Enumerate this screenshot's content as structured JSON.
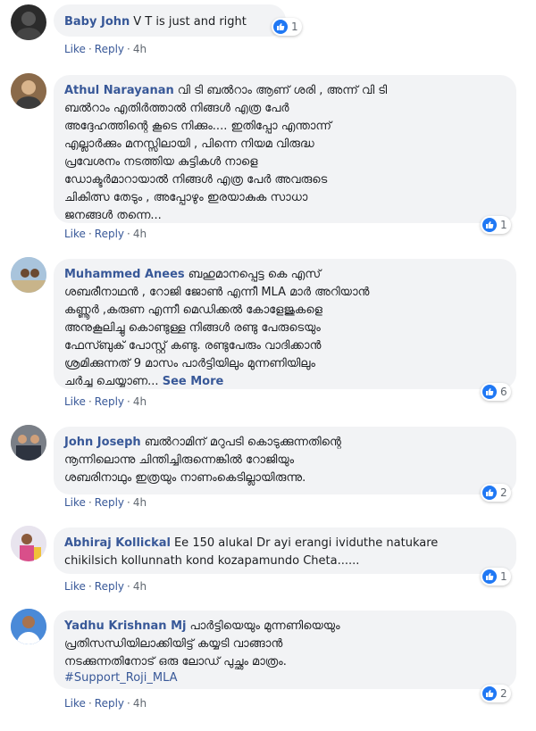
{
  "comments": [
    {
      "author": "Baby John",
      "text": "V T is just and right",
      "reactions": "1",
      "like_label": "Like",
      "reply_label": "Reply",
      "time": "4h"
    },
    {
      "author": "Athul Narayanan",
      "text": "വി ടി ബൽറാം ആണ് ശരി , അന്ന് വി ടി\nബൽറാം എതിർത്താൽ നിങ്ങൾ എത്ര പേർ\nഅദ്ദേഹത്തിന്റെ കൂടെ നിക്കും.... ഇതിപ്പോ എന്താന്ന്\nഎല്ലാർക്കും മനസ്സിലായി , പിന്നെ നിയമ വിരുദ്ധ\nപ്രവേശനം നടത്തിയ കുട്ടികൾ നാളെ\nഡോക്ടർമാറായാൽ നിങ്ങൾ എത്ര പേർ അവരുടെ\nചികിത്സ തേടും , അപ്പോഴും ഇരയാകുക സാധാ\nജനങ്ങൾ തന്നെ...",
      "reactions": "1",
      "like_label": "Like",
      "reply_label": "Reply",
      "time": "4h"
    },
    {
      "author": "Muhammed Anees",
      "text": "ബഹുമാനപ്പെട്ട കെ എസ്\nശബരീനാഥൻ , റോജി ജോൺ എന്നീ MLA മാർ അറിയാൻ\nകണ്ണൂർ ,കരുണ എന്നീ മെഡിക്കൽ കോളേജുകളെ\nഅനുകൂലിച്ചു കൊണ്ടുള്ള നിങ്ങൾ രണ്ടു പേരുടെയും\nഫേസ്ബുക് പോസ്റ്റ്‌ കണ്ടു. രണ്ടുപേരും വാദിക്കാൻ\nശ്രമിക്കുന്നത് 9 മാസം പാർട്ടിയിലും മുന്നണിയിലും\nചർച്ച ചെയ്യാണ...",
      "see_more": "See More",
      "reactions": "6",
      "like_label": "Like",
      "reply_label": "Reply",
      "time": "4h"
    },
    {
      "author": "John Joseph",
      "text": "ബൽറാമിന് മറുപടി കൊടുക്കുന്നതിന്റെ\nനൂന്നിലൊന്നു ചിന്തിച്ചിരുന്നെങ്കിൽ റോജിയും\nശബരിനാഥും ഇത്രയും നാണംകെടില്ലായിരുന്നു.",
      "reactions": "2",
      "like_label": "Like",
      "reply_label": "Reply",
      "time": "4h"
    },
    {
      "author": "Abhiraj Kollickal",
      "text": "Ee 150 alukal Dr ayi erangi ividuthe natukare\nchikilsich kollunnath kond kozapamundo Cheta......",
      "reactions": "1",
      "like_label": "Like",
      "reply_label": "Reply",
      "time": "4h"
    },
    {
      "author": "Yadhu Krishnan Mj",
      "text": "പാർട്ടിയെയും മുന്നണിയെയും\nപ്രതിസന്ധിയിലാക്കിയിട്ട് കയ്യടി വാങ്ങാൻ\nനടക്കുന്നതിനോട് ഒരു ലോഡ് പുച്ഛം മാത്രം.",
      "hashtag": "#Support_Roji_MLA",
      "reactions": "2",
      "like_label": "Like",
      "reply_label": "Reply",
      "time": "4h"
    }
  ],
  "colors": {
    "author": "#385898",
    "bubble": "#f2f3f5",
    "like_blue": "#2078f4",
    "meta": "#606770"
  },
  "icons": [
    "thumbs-up-icon",
    "avatar"
  ]
}
